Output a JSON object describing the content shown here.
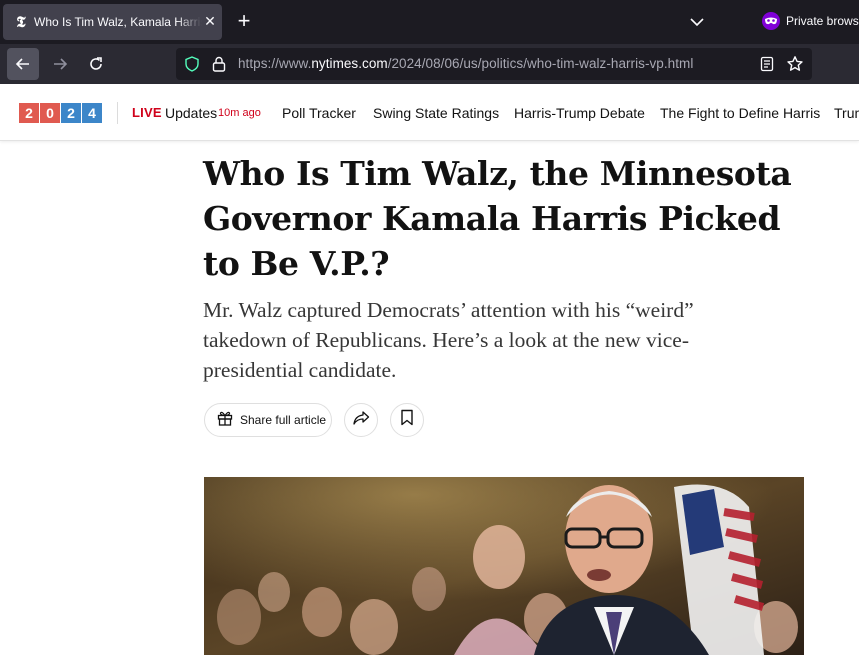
{
  "browser": {
    "tab": {
      "title": "Who Is Tim Walz, Kamala Harris Picked to Be V.P.?",
      "favicon": "nyt-logo-icon"
    },
    "private_label": "Private browsing",
    "url": {
      "prefix": "https://www.",
      "host": "nytimes.com",
      "path": "/2024/08/06/us/politics/who-tim-walz-harris-vp.html"
    }
  },
  "site_nav": {
    "badge_digits": [
      "2",
      "0",
      "2",
      "4"
    ],
    "live": "LIVE",
    "updates": "Updates",
    "updated_ago": "10m ago",
    "links": [
      "Poll Tracker",
      "Swing State Ratings",
      "Harris-Trump Debate",
      "The Fight to Define Harris",
      "Trump"
    ]
  },
  "article": {
    "headline": "Who Is Tim Walz, the Minnesota Governor Kamala Harris Picked to Be V.P.?",
    "summary": "Mr. Walz captured Democrats’ attention with his “weird” takedown of Republicans. Here’s a look at the new vice-presidential candidate.",
    "share_label": "Share full article"
  },
  "colors": {
    "live_red": "#d0021b",
    "badge_red": "#e05a50",
    "badge_blue": "#3c86c9",
    "private_purple": "#8000d7"
  }
}
